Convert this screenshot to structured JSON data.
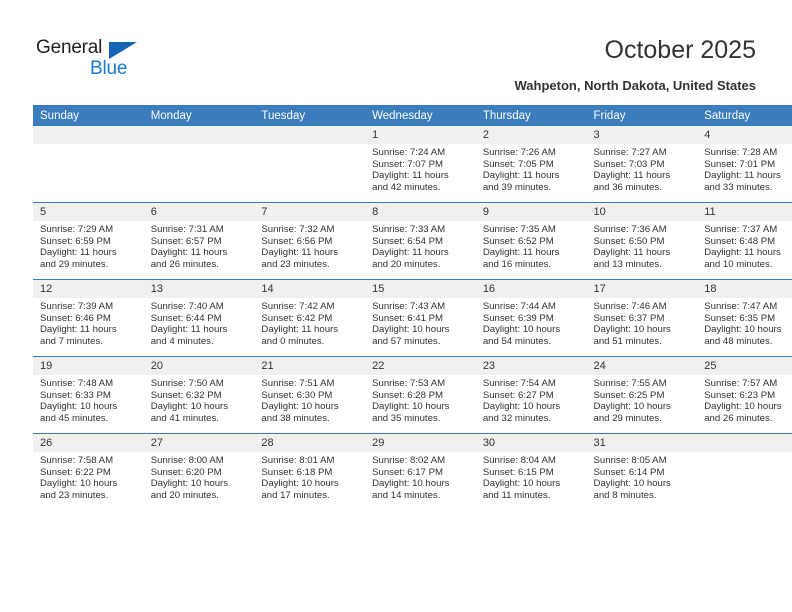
{
  "brand": {
    "name_top": "General",
    "name_bottom": "Blue",
    "accent_color": "#1879cd",
    "triangle_color": "#1565b8"
  },
  "header": {
    "title": "October 2025",
    "subtitle": "Wahpeton, North Dakota, United States"
  },
  "calendar": {
    "header_bg": "#3b7cbd",
    "daynumber_bg": "#f0f0f0",
    "weekdays": [
      "Sunday",
      "Monday",
      "Tuesday",
      "Wednesday",
      "Thursday",
      "Friday",
      "Saturday"
    ],
    "weeks": [
      [
        {
          "day": "",
          "sunrise": "",
          "sunset": "",
          "daylight_line1": "",
          "daylight_line2": ""
        },
        {
          "day": "",
          "sunrise": "",
          "sunset": "",
          "daylight_line1": "",
          "daylight_line2": ""
        },
        {
          "day": "",
          "sunrise": "",
          "sunset": "",
          "daylight_line1": "",
          "daylight_line2": ""
        },
        {
          "day": "1",
          "sunrise": "Sunrise: 7:24 AM",
          "sunset": "Sunset: 7:07 PM",
          "daylight_line1": "Daylight: 11 hours",
          "daylight_line2": "and 42 minutes."
        },
        {
          "day": "2",
          "sunrise": "Sunrise: 7:26 AM",
          "sunset": "Sunset: 7:05 PM",
          "daylight_line1": "Daylight: 11 hours",
          "daylight_line2": "and 39 minutes."
        },
        {
          "day": "3",
          "sunrise": "Sunrise: 7:27 AM",
          "sunset": "Sunset: 7:03 PM",
          "daylight_line1": "Daylight: 11 hours",
          "daylight_line2": "and 36 minutes."
        },
        {
          "day": "4",
          "sunrise": "Sunrise: 7:28 AM",
          "sunset": "Sunset: 7:01 PM",
          "daylight_line1": "Daylight: 11 hours",
          "daylight_line2": "and 33 minutes."
        }
      ],
      [
        {
          "day": "5",
          "sunrise": "Sunrise: 7:29 AM",
          "sunset": "Sunset: 6:59 PM",
          "daylight_line1": "Daylight: 11 hours",
          "daylight_line2": "and 29 minutes."
        },
        {
          "day": "6",
          "sunrise": "Sunrise: 7:31 AM",
          "sunset": "Sunset: 6:57 PM",
          "daylight_line1": "Daylight: 11 hours",
          "daylight_line2": "and 26 minutes."
        },
        {
          "day": "7",
          "sunrise": "Sunrise: 7:32 AM",
          "sunset": "Sunset: 6:56 PM",
          "daylight_line1": "Daylight: 11 hours",
          "daylight_line2": "and 23 minutes."
        },
        {
          "day": "8",
          "sunrise": "Sunrise: 7:33 AM",
          "sunset": "Sunset: 6:54 PM",
          "daylight_line1": "Daylight: 11 hours",
          "daylight_line2": "and 20 minutes."
        },
        {
          "day": "9",
          "sunrise": "Sunrise: 7:35 AM",
          "sunset": "Sunset: 6:52 PM",
          "daylight_line1": "Daylight: 11 hours",
          "daylight_line2": "and 16 minutes."
        },
        {
          "day": "10",
          "sunrise": "Sunrise: 7:36 AM",
          "sunset": "Sunset: 6:50 PM",
          "daylight_line1": "Daylight: 11 hours",
          "daylight_line2": "and 13 minutes."
        },
        {
          "day": "11",
          "sunrise": "Sunrise: 7:37 AM",
          "sunset": "Sunset: 6:48 PM",
          "daylight_line1": "Daylight: 11 hours",
          "daylight_line2": "and 10 minutes."
        }
      ],
      [
        {
          "day": "12",
          "sunrise": "Sunrise: 7:39 AM",
          "sunset": "Sunset: 6:46 PM",
          "daylight_line1": "Daylight: 11 hours",
          "daylight_line2": "and 7 minutes."
        },
        {
          "day": "13",
          "sunrise": "Sunrise: 7:40 AM",
          "sunset": "Sunset: 6:44 PM",
          "daylight_line1": "Daylight: 11 hours",
          "daylight_line2": "and 4 minutes."
        },
        {
          "day": "14",
          "sunrise": "Sunrise: 7:42 AM",
          "sunset": "Sunset: 6:42 PM",
          "daylight_line1": "Daylight: 11 hours",
          "daylight_line2": "and 0 minutes."
        },
        {
          "day": "15",
          "sunrise": "Sunrise: 7:43 AM",
          "sunset": "Sunset: 6:41 PM",
          "daylight_line1": "Daylight: 10 hours",
          "daylight_line2": "and 57 minutes."
        },
        {
          "day": "16",
          "sunrise": "Sunrise: 7:44 AM",
          "sunset": "Sunset: 6:39 PM",
          "daylight_line1": "Daylight: 10 hours",
          "daylight_line2": "and 54 minutes."
        },
        {
          "day": "17",
          "sunrise": "Sunrise: 7:46 AM",
          "sunset": "Sunset: 6:37 PM",
          "daylight_line1": "Daylight: 10 hours",
          "daylight_line2": "and 51 minutes."
        },
        {
          "day": "18",
          "sunrise": "Sunrise: 7:47 AM",
          "sunset": "Sunset: 6:35 PM",
          "daylight_line1": "Daylight: 10 hours",
          "daylight_line2": "and 48 minutes."
        }
      ],
      [
        {
          "day": "19",
          "sunrise": "Sunrise: 7:48 AM",
          "sunset": "Sunset: 6:33 PM",
          "daylight_line1": "Daylight: 10 hours",
          "daylight_line2": "and 45 minutes."
        },
        {
          "day": "20",
          "sunrise": "Sunrise: 7:50 AM",
          "sunset": "Sunset: 6:32 PM",
          "daylight_line1": "Daylight: 10 hours",
          "daylight_line2": "and 41 minutes."
        },
        {
          "day": "21",
          "sunrise": "Sunrise: 7:51 AM",
          "sunset": "Sunset: 6:30 PM",
          "daylight_line1": "Daylight: 10 hours",
          "daylight_line2": "and 38 minutes."
        },
        {
          "day": "22",
          "sunrise": "Sunrise: 7:53 AM",
          "sunset": "Sunset: 6:28 PM",
          "daylight_line1": "Daylight: 10 hours",
          "daylight_line2": "and 35 minutes."
        },
        {
          "day": "23",
          "sunrise": "Sunrise: 7:54 AM",
          "sunset": "Sunset: 6:27 PM",
          "daylight_line1": "Daylight: 10 hours",
          "daylight_line2": "and 32 minutes."
        },
        {
          "day": "24",
          "sunrise": "Sunrise: 7:55 AM",
          "sunset": "Sunset: 6:25 PM",
          "daylight_line1": "Daylight: 10 hours",
          "daylight_line2": "and 29 minutes."
        },
        {
          "day": "25",
          "sunrise": "Sunrise: 7:57 AM",
          "sunset": "Sunset: 6:23 PM",
          "daylight_line1": "Daylight: 10 hours",
          "daylight_line2": "and 26 minutes."
        }
      ],
      [
        {
          "day": "26",
          "sunrise": "Sunrise: 7:58 AM",
          "sunset": "Sunset: 6:22 PM",
          "daylight_line1": "Daylight: 10 hours",
          "daylight_line2": "and 23 minutes."
        },
        {
          "day": "27",
          "sunrise": "Sunrise: 8:00 AM",
          "sunset": "Sunset: 6:20 PM",
          "daylight_line1": "Daylight: 10 hours",
          "daylight_line2": "and 20 minutes."
        },
        {
          "day": "28",
          "sunrise": "Sunrise: 8:01 AM",
          "sunset": "Sunset: 6:18 PM",
          "daylight_line1": "Daylight: 10 hours",
          "daylight_line2": "and 17 minutes."
        },
        {
          "day": "29",
          "sunrise": "Sunrise: 8:02 AM",
          "sunset": "Sunset: 6:17 PM",
          "daylight_line1": "Daylight: 10 hours",
          "daylight_line2": "and 14 minutes."
        },
        {
          "day": "30",
          "sunrise": "Sunrise: 8:04 AM",
          "sunset": "Sunset: 6:15 PM",
          "daylight_line1": "Daylight: 10 hours",
          "daylight_line2": "and 11 minutes."
        },
        {
          "day": "31",
          "sunrise": "Sunrise: 8:05 AM",
          "sunset": "Sunset: 6:14 PM",
          "daylight_line1": "Daylight: 10 hours",
          "daylight_line2": "and 8 minutes."
        },
        {
          "day": "",
          "sunrise": "",
          "sunset": "",
          "daylight_line1": "",
          "daylight_line2": ""
        }
      ]
    ]
  }
}
